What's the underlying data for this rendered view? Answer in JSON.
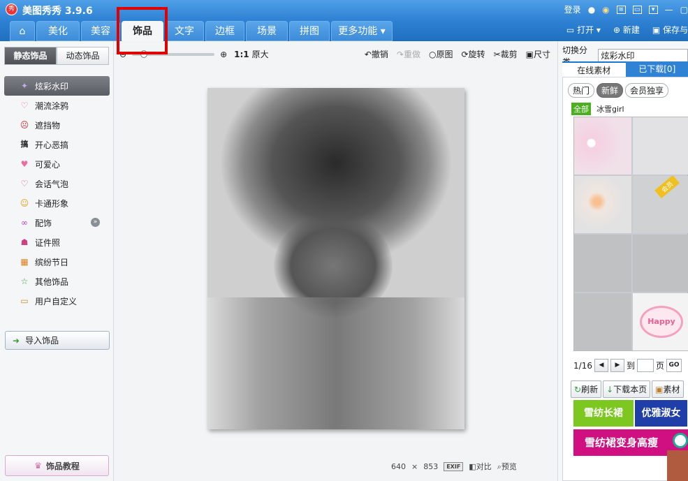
{
  "title": {
    "app": "美图秀秀 3.9.6",
    "logo_char": "秀",
    "login": "登录"
  },
  "tabs": [
    {
      "label": "美化"
    },
    {
      "label": "美容"
    },
    {
      "label": "饰品"
    },
    {
      "label": "文字"
    },
    {
      "label": "边框"
    },
    {
      "label": "场景"
    },
    {
      "label": "拼图"
    },
    {
      "label": "更多功能 ▾"
    }
  ],
  "top_actions": {
    "open": "打开",
    "new": "新建",
    "save": "保存与"
  },
  "left": {
    "seg_static": "静态饰品",
    "seg_dynamic": "动态饰品",
    "categories": [
      {
        "label": "炫彩水印",
        "icon": "✦"
      },
      {
        "label": "潮流涂鸦",
        "icon": "♡"
      },
      {
        "label": "遮挡物",
        "icon": "☹"
      },
      {
        "label": "开心恶搞",
        "icon": "搞"
      },
      {
        "label": "可爱心",
        "icon": "♥"
      },
      {
        "label": "会话气泡",
        "icon": "♡"
      },
      {
        "label": "卡通形象",
        "icon": "☺"
      },
      {
        "label": "配饰",
        "icon": "∞"
      },
      {
        "label": "证件照",
        "icon": "☗"
      },
      {
        "label": "缤纷节日",
        "icon": "▦"
      },
      {
        "label": "其他饰品",
        "icon": "☆"
      },
      {
        "label": "用户自定义",
        "icon": "▭"
      }
    ],
    "import_label": "导入饰品",
    "tutorial_label": "饰品教程"
  },
  "toolbar": {
    "ratio": "1:1",
    "original_size": "原大",
    "undo": "撤销",
    "redo": "重做",
    "original": "原图",
    "rotate": "旋转",
    "crop": "裁剪",
    "resize": "尺寸"
  },
  "status": {
    "width": "640",
    "x": "×",
    "height": "853",
    "exif": "EXIF",
    "compare": "对比",
    "preview": "预览"
  },
  "right": {
    "switch_label": "切换分类",
    "switch_value": "炫彩水印",
    "tab_online": "在线素材",
    "tab_downloaded": "已下载[0]",
    "chips": [
      "热门",
      "新鲜",
      "会员独享"
    ],
    "all_label": "全部",
    "author": "冰雪girl",
    "vip_label": "会员",
    "happy_label": "Happy",
    "pager": {
      "page": "1/16",
      "to": "到",
      "unit": "页",
      "go": "GO"
    },
    "actions": {
      "refresh": "刷新",
      "download": "下载本页",
      "material": "素材"
    },
    "ads": [
      "雪纺长裙",
      "优雅淑女",
      "雪纺裙变身高瘦"
    ]
  }
}
